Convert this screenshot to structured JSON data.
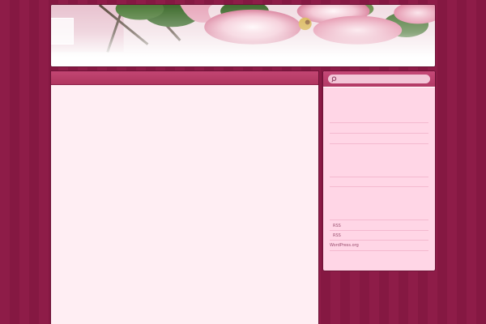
{
  "sidebar": {
    "search": {
      "placeholder": ""
    },
    "meta_links": [
      {
        "label": "RSS"
      },
      {
        "label": "RSS"
      },
      {
        "label": "WordPress.org"
      }
    ]
  },
  "colors": {
    "background": "#8a1a45",
    "content_bg": "#ffeef3",
    "sidebar_bg": "#ffd6e6",
    "accent_bar": "#b83a66"
  },
  "icons": {
    "search": "search-icon"
  }
}
